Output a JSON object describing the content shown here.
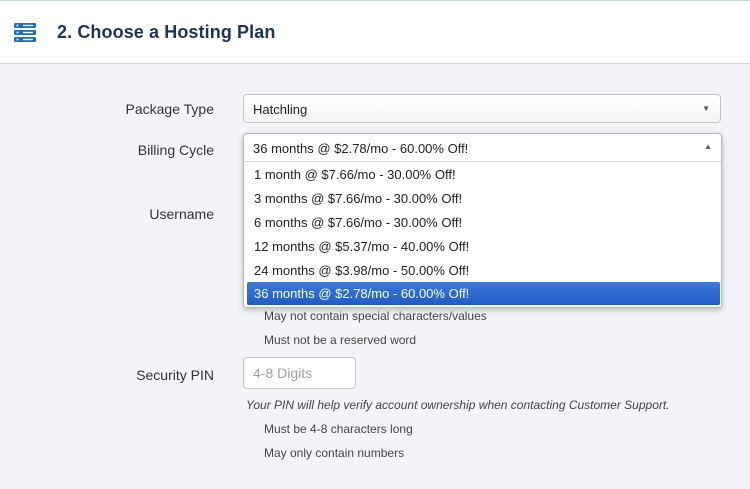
{
  "header": {
    "icon": "server-stack-icon",
    "title": "2. Choose a Hosting Plan",
    "accent": "#1b6fc2"
  },
  "form": {
    "package_type": {
      "label": "Package Type",
      "value": "Hatchling"
    },
    "billing_cycle": {
      "label": "Billing Cycle",
      "value": "36 months @ $2.78/mo - 60.00% Off!",
      "options": [
        "1 month @ $7.66/mo - 30.00% Off!",
        "3 months @ $7.66/mo - 30.00% Off!",
        "6 months @ $7.66/mo - 30.00% Off!",
        "12 months @ $5.37/mo - 40.00% Off!",
        "24 months @ $3.98/mo - 50.00% Off!",
        "36 months @ $2.78/mo - 60.00% Off!"
      ],
      "highlight_color": "#2a66cc"
    },
    "username": {
      "label": "Username",
      "hints": [
        "May not contain special characters/values",
        "Must not be a reserved word"
      ]
    },
    "security_pin": {
      "label": "Security PIN",
      "placeholder": "4-8 Digits",
      "note": "Your PIN will help verify account ownership when contacting Customer Support.",
      "hints": [
        "Must be 4-8 characters long",
        "May only contain numbers"
      ]
    }
  }
}
